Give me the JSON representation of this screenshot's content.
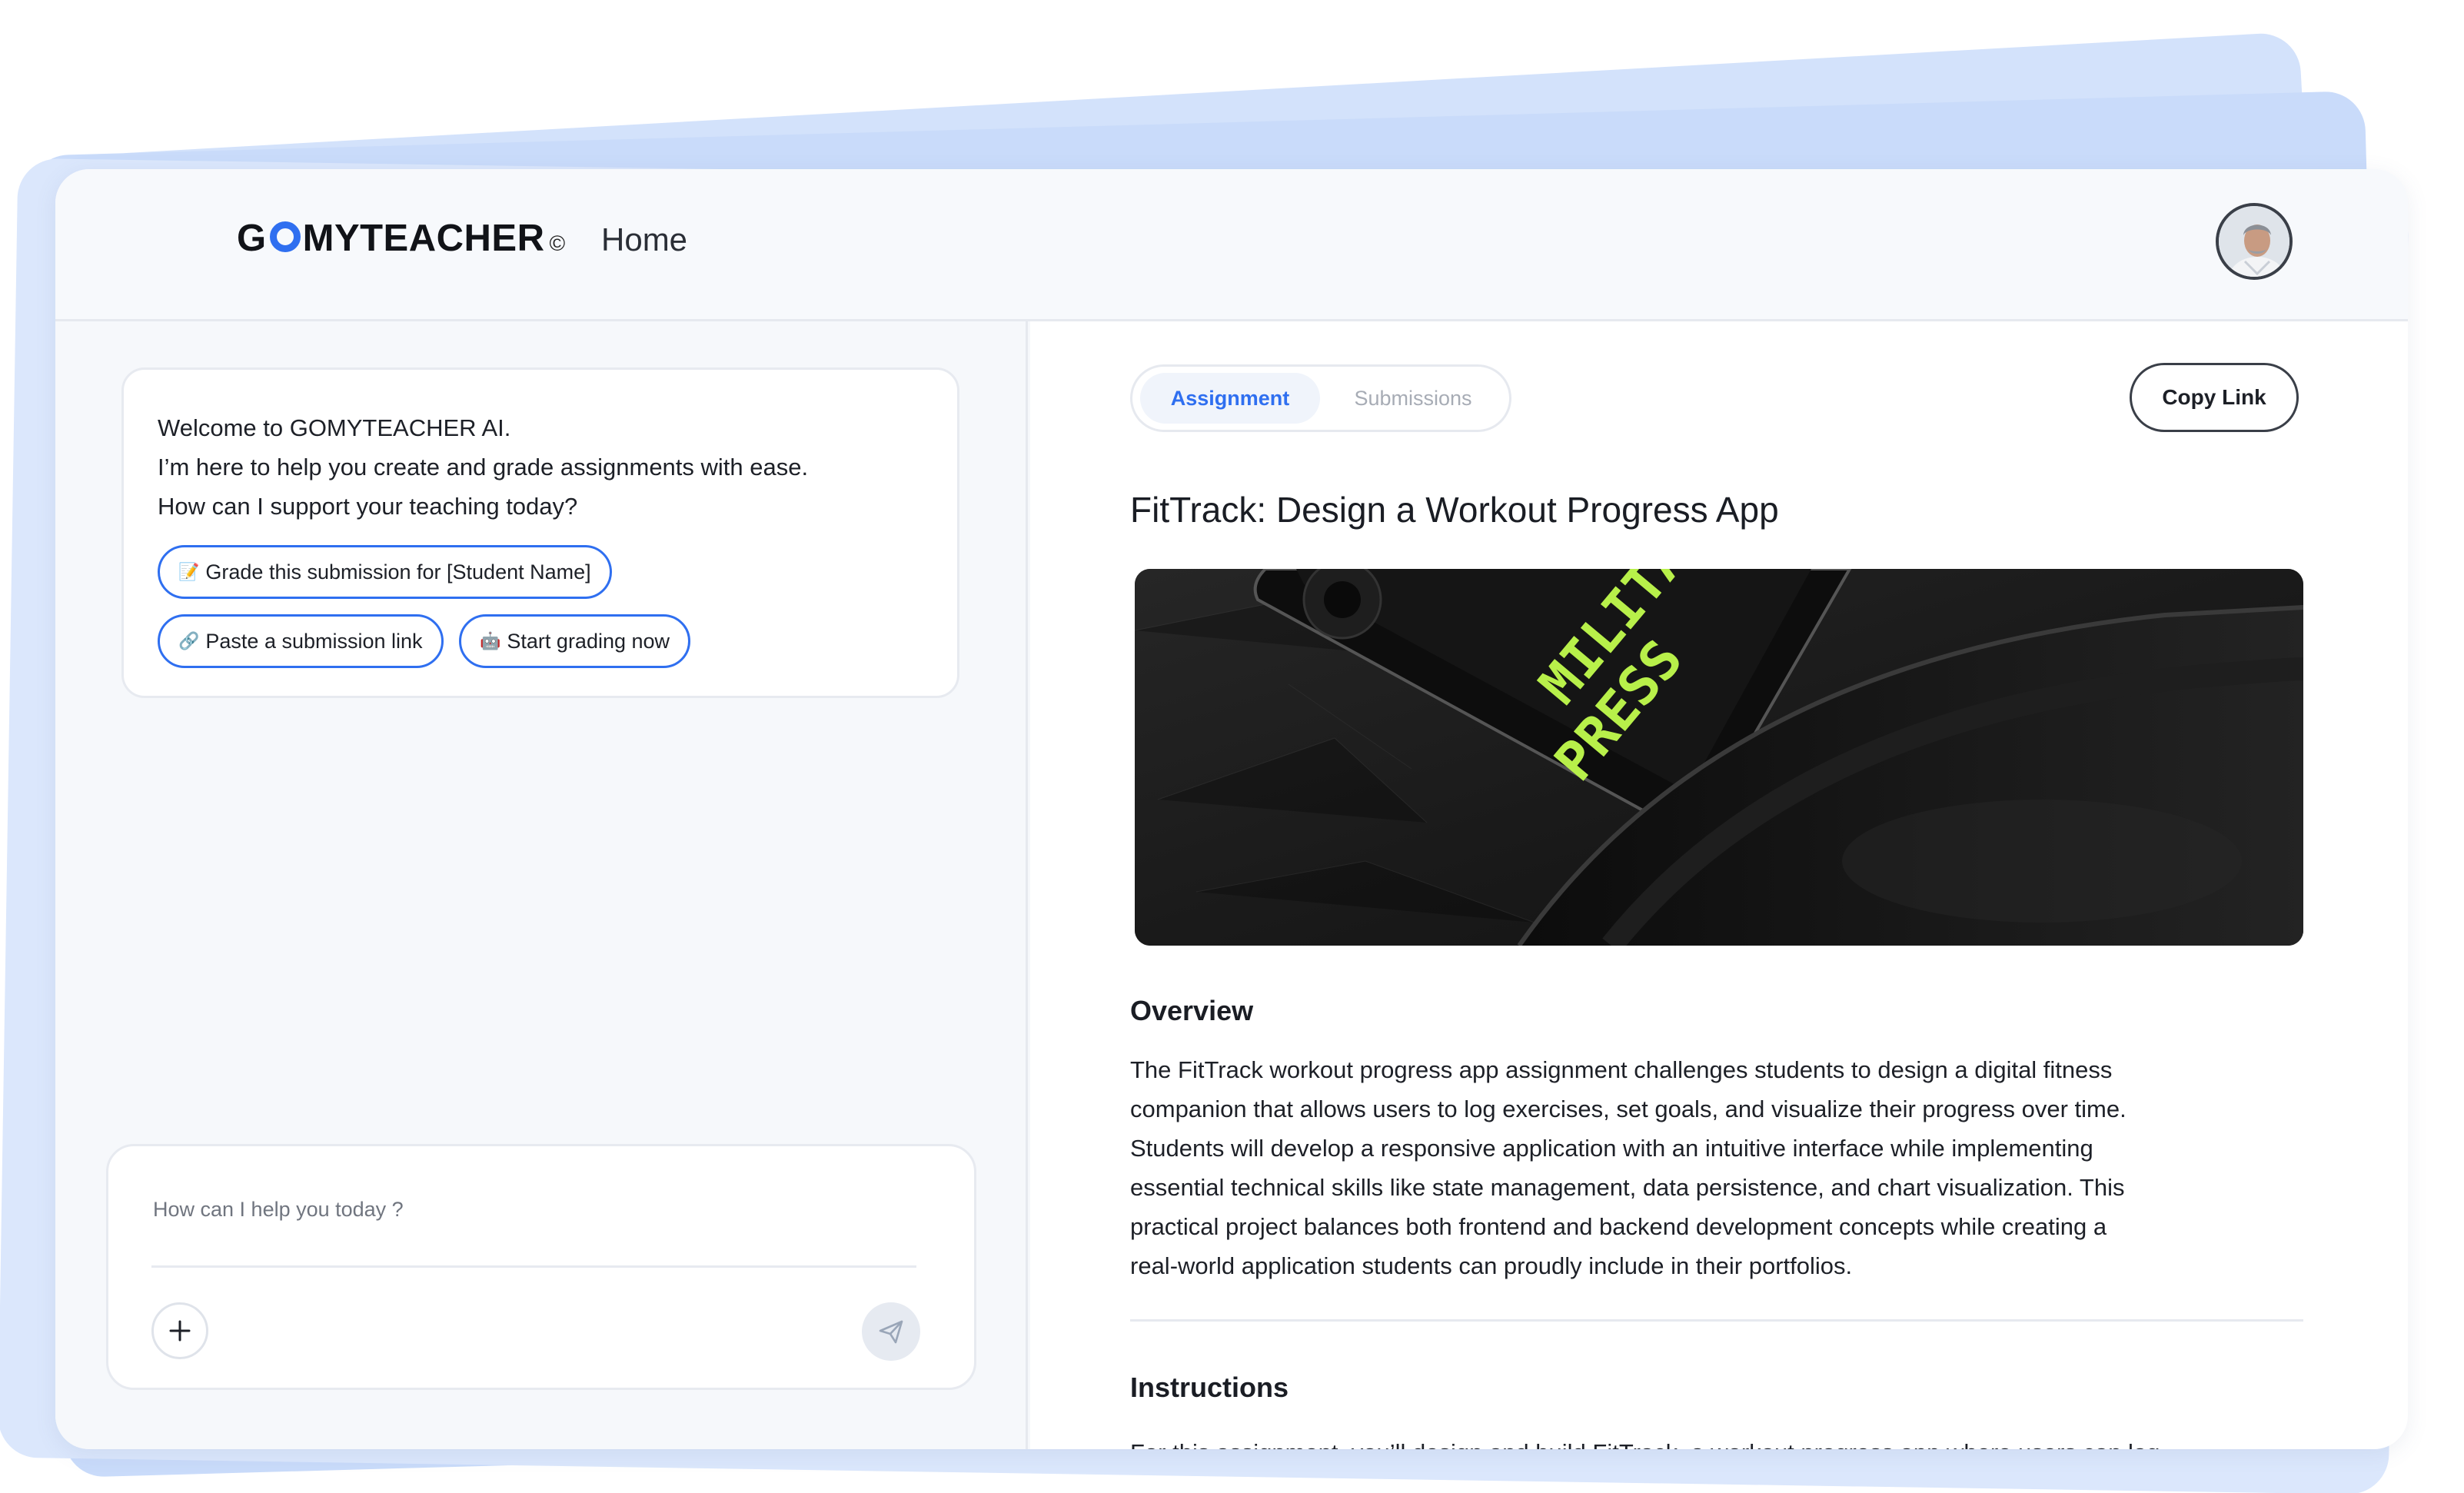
{
  "app": {
    "brand": "GOMYTEACHER",
    "brand_prefix": "G",
    "brand_suffix": "MYTEACHER",
    "brand_mark": "©",
    "nav_home": "Home",
    "accent_color": "#2f6ff0"
  },
  "assistant": {
    "welcome_lines": [
      "Welcome to GOMYTEACHER AI.",
      "I’m here to help you create and grade assignments with ease.",
      "How can I support your teaching today?"
    ],
    "suggestions": [
      {
        "icon": "memo-icon",
        "glyph": "📝",
        "label": "Grade this submission for [Student Name]"
      },
      {
        "icon": "link-icon",
        "glyph": "🔗",
        "label": "Paste a submission link"
      },
      {
        "icon": "robot-icon",
        "glyph": "🤖",
        "label": "Start grading now"
      }
    ],
    "composer_placeholder": "How can I help you today ?"
  },
  "assignment": {
    "tabs": [
      {
        "label": "Assignment",
        "active": true
      },
      {
        "label": "Submissions",
        "active": false
      }
    ],
    "copy_link_label": "Copy Link",
    "title": "FitTrack: Design a Workout Progress App",
    "hero_text": "MILITARY PRESS",
    "overview_heading": "Overview",
    "overview_lines": [
      "The FitTrack workout progress app assignment challenges students to design a digital fitness",
      "companion that allows users to log exercises, set goals, and visualize their progress over time.",
      "Students will develop a responsive application with an intuitive interface while implementing",
      "essential technical skills like state management, data persistence, and chart visualization. This",
      "practical project balances both frontend and backend development concepts while creating a",
      "real-world application students can proudly include in their portfolios."
    ],
    "instructions_heading": "Instructions",
    "instructions_preview": "For this assignment, you’ll design and build FitTrack, a workout progress app where users can log"
  }
}
